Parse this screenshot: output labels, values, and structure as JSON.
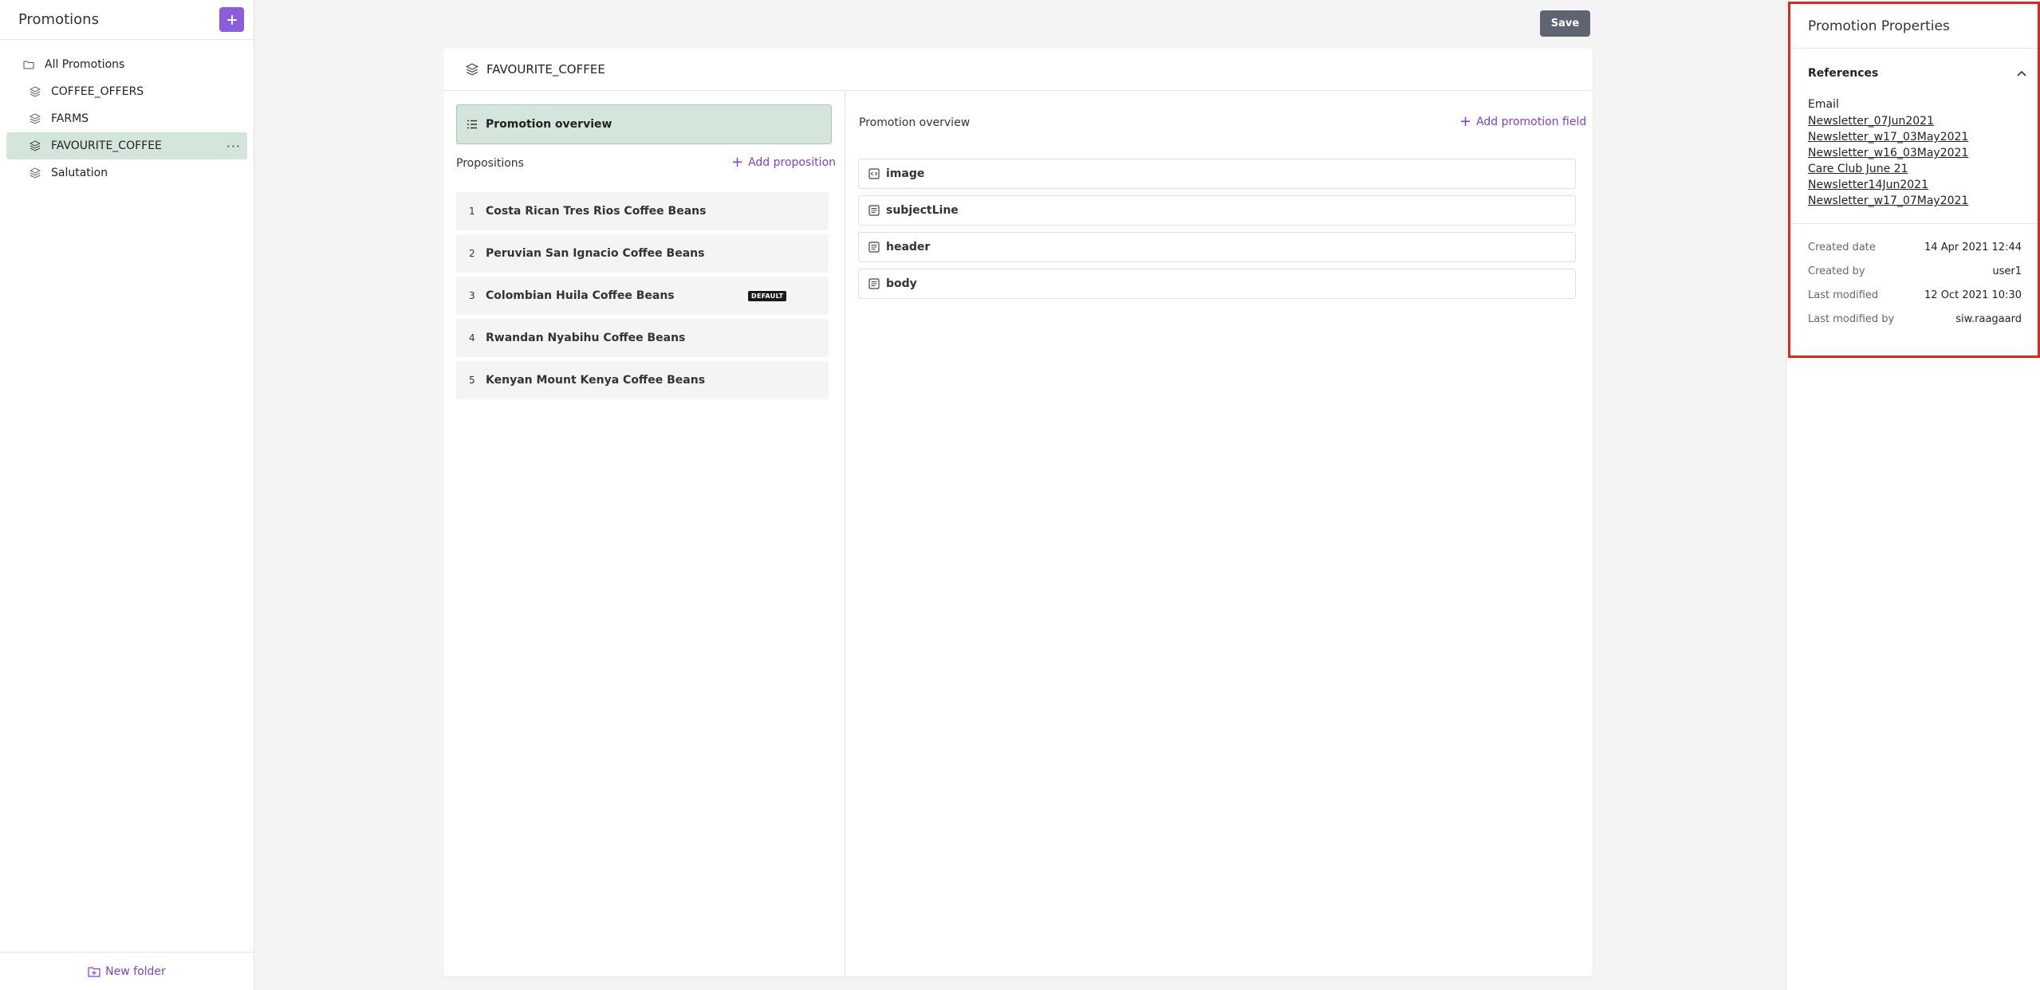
{
  "sidebar": {
    "title": "Promotions",
    "items": [
      {
        "label": "All Promotions",
        "icon": "folder-icon"
      },
      {
        "label": "COFFEE_OFFERS",
        "icon": "layers-icon"
      },
      {
        "label": "FARMS",
        "icon": "layers-icon"
      },
      {
        "label": "FAVOURITE_COFFEE",
        "icon": "layers-icon",
        "selected": true
      },
      {
        "label": "Salutation",
        "icon": "layers-icon"
      }
    ],
    "more_label": "···",
    "new_folder_label": "New folder"
  },
  "toolbar": {
    "save_label": "Save"
  },
  "promotion": {
    "name": "FAVOURITE_COFFEE",
    "overview_button": "Promotion overview",
    "propositions_label": "Propositions",
    "add_proposition_label": "Add proposition",
    "propositions": [
      {
        "num": "1",
        "label": "Costa Rican Tres Rios Coffee Beans"
      },
      {
        "num": "2",
        "label": "Peruvian San Ignacio Coffee Beans"
      },
      {
        "num": "3",
        "label": "Colombian Huila Coffee Beans",
        "badge": "DEFAULT"
      },
      {
        "num": "4",
        "label": "Rwandan Nyabihu Coffee Beans"
      },
      {
        "num": "5",
        "label": "Kenyan Mount Kenya Coffee Beans"
      }
    ],
    "overview_title": "Promotion overview",
    "add_field_label": "Add promotion field",
    "fields": [
      {
        "label": "image",
        "icon": "code-icon"
      },
      {
        "label": "subjectLine",
        "icon": "text-icon"
      },
      {
        "label": "header",
        "icon": "text-icon"
      },
      {
        "label": "body",
        "icon": "text-icon"
      }
    ]
  },
  "properties": {
    "title": "Promotion Properties",
    "references_label": "References",
    "ref_type": "Email",
    "references": [
      "Newsletter_07Jun2021",
      "Newsletter_w17_03May2021",
      "Newsletter_w16_03May2021",
      "Care Club June 21",
      "Newsletter14Jun2021",
      "Newsletter_w17_07May2021"
    ],
    "meta": [
      {
        "key": "Created date",
        "value": "14 Apr 2021 12:44"
      },
      {
        "key": "Created by",
        "value": "user1"
      },
      {
        "key": "Last modified",
        "value": "12 Oct 2021 10:30"
      },
      {
        "key": "Last modified by",
        "value": "siw.raagaard"
      }
    ]
  },
  "colors": {
    "accent": "#8b5cdb",
    "selected": "#d4e6dc",
    "highlight_border": "#e0251b"
  }
}
